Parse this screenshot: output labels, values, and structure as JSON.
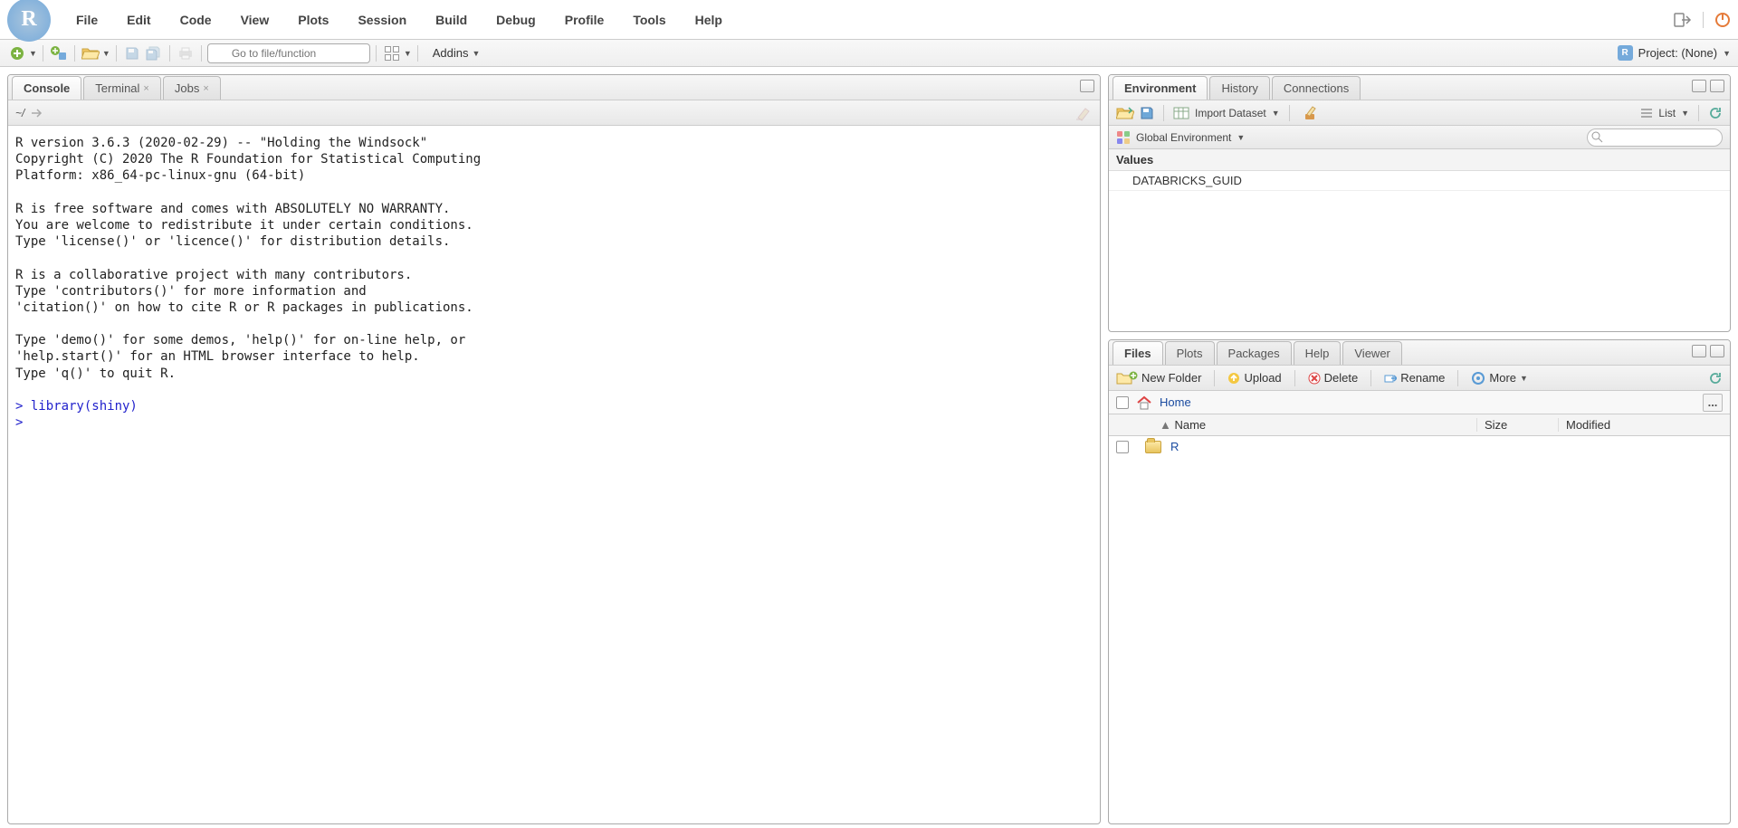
{
  "menubar": {
    "items": [
      "File",
      "Edit",
      "Code",
      "View",
      "Plots",
      "Session",
      "Build",
      "Debug",
      "Profile",
      "Tools",
      "Help"
    ],
    "user_label": ""
  },
  "toolbar": {
    "goto_placeholder": "Go to file/function",
    "addins_label": "Addins",
    "project_label": "Project: (None)"
  },
  "left_pane": {
    "tabs": [
      {
        "label": "Console",
        "closable": false,
        "active": true
      },
      {
        "label": "Terminal",
        "closable": true,
        "active": false
      },
      {
        "label": "Jobs",
        "closable": true,
        "active": false
      }
    ],
    "breadcrumb": "~/",
    "console_text": "R version 3.6.3 (2020-02-29) -- \"Holding the Windsock\"\nCopyright (C) 2020 The R Foundation for Statistical Computing\nPlatform: x86_64-pc-linux-gnu (64-bit)\n\nR is free software and comes with ABSOLUTELY NO WARRANTY.\nYou are welcome to redistribute it under certain conditions.\nType 'license()' or 'licence()' for distribution details.\n\nR is a collaborative project with many contributors.\nType 'contributors()' for more information and\n'citation()' on how to cite R or R packages in publications.\n\nType 'demo()' for some demos, 'help()' for on-line help, or\n'help.start()' for an HTML browser interface to help.\nType 'q()' to quit R.\n",
    "console_prompt1": "> library(shiny)",
    "console_prompt2": "> "
  },
  "env_pane": {
    "tabs": [
      "Environment",
      "History",
      "Connections"
    ],
    "active_tab": 0,
    "import_label": "Import Dataset",
    "scope_label": "Global Environment",
    "view_label": "List",
    "section": "Values",
    "rows": [
      {
        "name": "DATABRICKS_GUID",
        "value": ""
      }
    ]
  },
  "files_pane": {
    "tabs": [
      "Files",
      "Plots",
      "Packages",
      "Help",
      "Viewer"
    ],
    "active_tab": 0,
    "toolbar": {
      "new_folder": "New Folder",
      "upload": "Upload",
      "delete": "Delete",
      "rename": "Rename",
      "more": "More"
    },
    "breadcrumb_home": "Home",
    "columns": {
      "name": "Name",
      "size": "Size",
      "modified": "Modified"
    },
    "rows": [
      {
        "name": "R",
        "type": "folder"
      }
    ]
  }
}
